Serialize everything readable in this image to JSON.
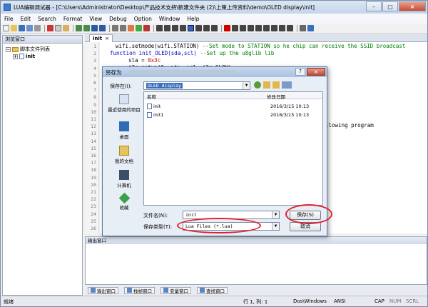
{
  "window": {
    "title": "LUA编辑调试器 - [C:\\Users\\Administrator\\Desktop\\产品技术支持\\新建文件夹 (2)\\上策上传资料\\demo\\OLED display\\init]"
  },
  "menu": [
    "File",
    "Edit",
    "Search",
    "Format",
    "View",
    "Debug",
    "Option",
    "Window",
    "Help"
  ],
  "left_panel": {
    "title": "浏览窗口",
    "root": "脚本文件列表",
    "child": "init"
  },
  "editor": {
    "tab": "init",
    "line_numbers": [
      "1",
      "2",
      "3",
      "4",
      "5",
      "6",
      "7",
      "8",
      "9",
      "10",
      "11",
      "12",
      "13",
      "14",
      "15",
      "16",
      "17",
      "18",
      "19",
      "20",
      "21",
      "22",
      "23",
      "24",
      "25",
      "26"
    ],
    "code": {
      "l1_a": "wifi.setmode(wifi.STATION) ",
      "l1_b": "--Set mode to STATION so he chip can receive the SSID broadcast",
      "l2_kw": "function ",
      "l2_fn": "init_OLED(sda,scl) ",
      "l2_cm": "--Set up the u8glib lib",
      "l3_a": "    sla = ",
      "l3_n": "0x3c",
      "l4": "    i2c.setup(0, sda, scl, i2c.SLOW)",
      "l9": "llowing program"
    }
  },
  "output": {
    "title": "输出窗口"
  },
  "bottom_tabs": [
    "输出窗口",
    "栈帧窗口",
    "变量窗口",
    "查找窗口"
  ],
  "status": {
    "ready": "就绪",
    "position": "行 1, 列: 1",
    "line_ending": "Dos\\Windows",
    "encoding": "ANSI",
    "cap": "CAP",
    "num": "NUM",
    "scrl": "SCRL"
  },
  "dialog": {
    "title": "另存为",
    "save_in_label": "保存在(I):",
    "save_in_value": "OLED display",
    "places": [
      "最近使用的项目",
      "桌面",
      "我的文档",
      "计算机",
      "收藏"
    ],
    "columns": {
      "name": "名称",
      "date": "修改日期"
    },
    "files": [
      {
        "name": "init",
        "date": "2016/3/15 10:13"
      },
      {
        "name": "init1",
        "date": "2016/3/15 10:13"
      }
    ],
    "filename_label": "文件名(N):",
    "filename_value": "init",
    "filetype_label": "保存类型(T):",
    "filetype_value": "Lua Files (*.lua)",
    "save_button": "保存(S)",
    "cancel_button": "取消",
    "help": "?",
    "close": "×"
  }
}
